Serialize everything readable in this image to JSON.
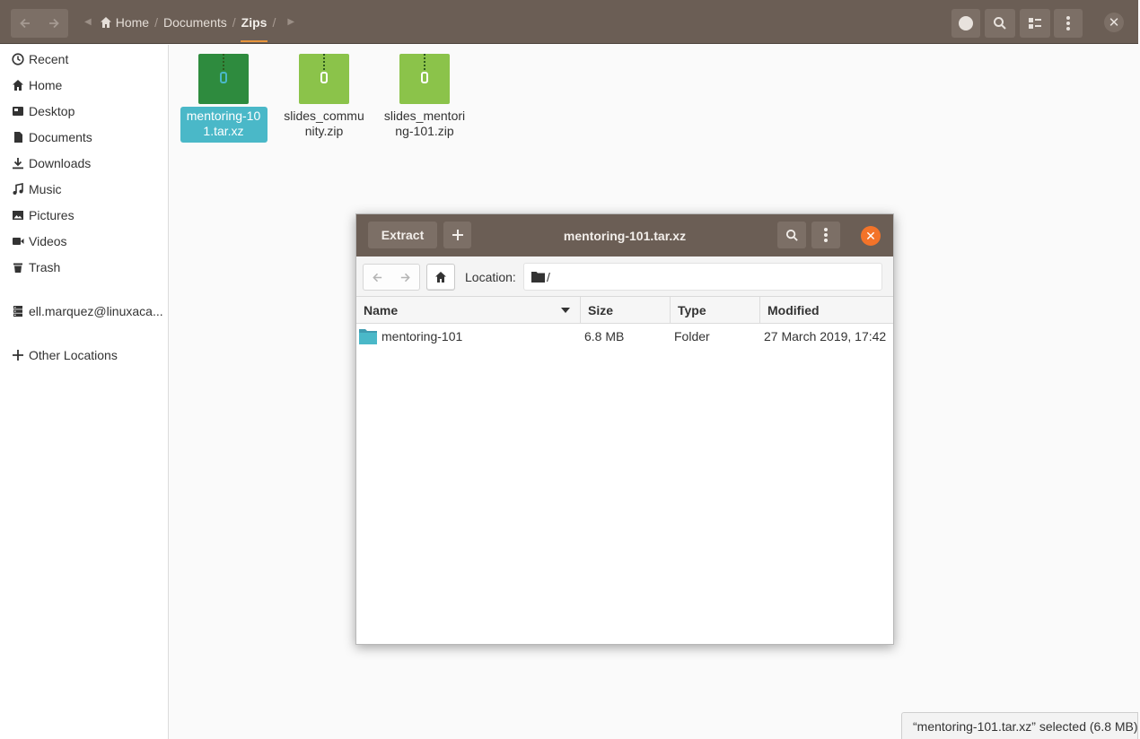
{
  "header": {
    "breadcrumbs": [
      "Home",
      "Documents",
      "Zips"
    ],
    "icons": {
      "back": "arrow-left-icon",
      "forward": "arrow-right-icon",
      "home": "home-icon",
      "search": "search-icon",
      "view": "list-view-icon",
      "menu": "menu-icon",
      "close": "close-icon"
    }
  },
  "sidebar": {
    "items": [
      {
        "label": "Recent",
        "icon": "clock-icon"
      },
      {
        "label": "Home",
        "icon": "home-icon"
      },
      {
        "label": "Desktop",
        "icon": "desktop-icon"
      },
      {
        "label": "Documents",
        "icon": "document-icon"
      },
      {
        "label": "Downloads",
        "icon": "download-icon"
      },
      {
        "label": "Music",
        "icon": "music-icon"
      },
      {
        "label": "Pictures",
        "icon": "picture-icon"
      },
      {
        "label": "Videos",
        "icon": "video-icon"
      },
      {
        "label": "Trash",
        "icon": "trash-icon"
      },
      {
        "label": "ell.marquez@linuxaca...",
        "icon": "server-icon"
      },
      {
        "label": "Other Locations",
        "icon": "plus-icon"
      }
    ]
  },
  "files": [
    {
      "name": "mentoring-101.tar.xz",
      "selected": true,
      "icon_color": "#2e8b3e"
    },
    {
      "name": "slides_community.zip",
      "selected": false,
      "icon_color": "#8bc34a"
    },
    {
      "name": "slides_mentoring-101.zip",
      "selected": false,
      "icon_color": "#8bc34a"
    }
  ],
  "dialog": {
    "title": "mentoring-101.tar.xz",
    "extract_label": "Extract",
    "location_label": "Location:",
    "location_value": "/",
    "columns": [
      "Name",
      "Size",
      "Type",
      "Modified"
    ],
    "rows": [
      {
        "name": "mentoring-101",
        "size": "6.8 MB",
        "type": "Folder",
        "modified": "27 March 2019, 17:42"
      }
    ],
    "close_color": "#f37329"
  },
  "status": "“mentoring-101.tar.xz” selected  (6.8 MB)",
  "colors": {
    "headerbar": "#6b5e55",
    "selection": "#4ab8c8",
    "accent": "#e7953d"
  }
}
